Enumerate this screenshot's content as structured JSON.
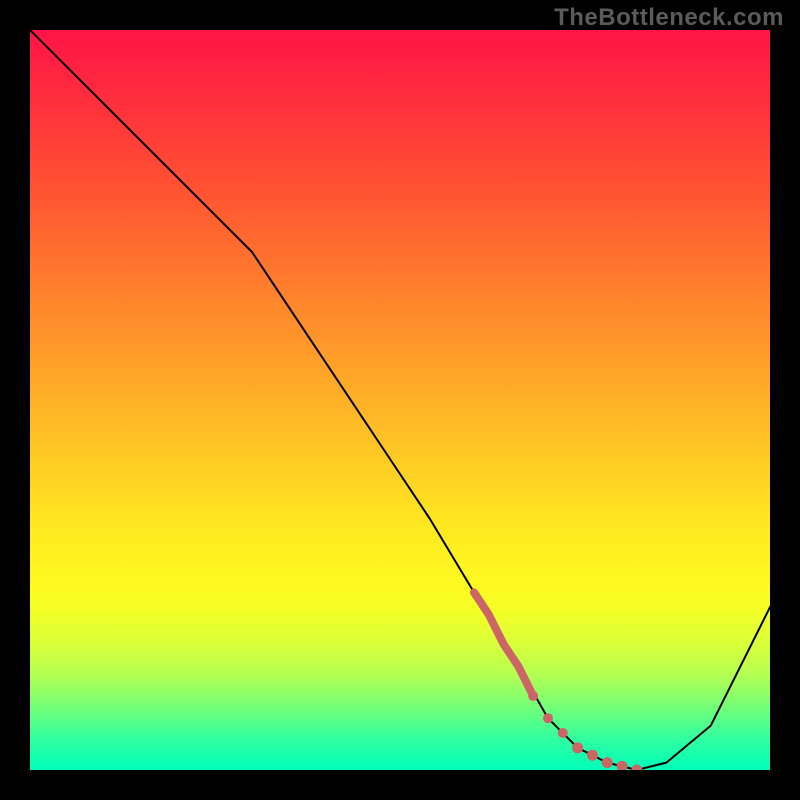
{
  "watermark": "TheBottleneck.com",
  "chart_data": {
    "type": "line",
    "title": "",
    "xlabel": "",
    "ylabel": "",
    "xlim": [
      0,
      100
    ],
    "ylim": [
      0,
      100
    ],
    "series": [
      {
        "name": "bottleneck-curve",
        "x": [
          0,
          4,
          10,
          18,
          24,
          30,
          38,
          46,
          54,
          60,
          66,
          70,
          74,
          78,
          82,
          86,
          92,
          100
        ],
        "y": [
          100,
          96,
          90,
          82,
          76,
          70,
          58,
          46,
          34,
          24,
          14,
          7,
          3,
          1,
          0,
          1,
          6,
          22
        ]
      }
    ],
    "markers": {
      "name": "highlight-segment",
      "color": "#cc6666",
      "x": [
        60,
        62,
        64,
        66,
        68,
        70,
        72,
        74,
        76,
        78,
        80,
        82
      ],
      "y": [
        24,
        21,
        17,
        14,
        10,
        7,
        5,
        3,
        2,
        1,
        0.5,
        0
      ]
    },
    "background_gradient": {
      "top": "#ff1446",
      "bottom": "#00ffb9"
    }
  }
}
